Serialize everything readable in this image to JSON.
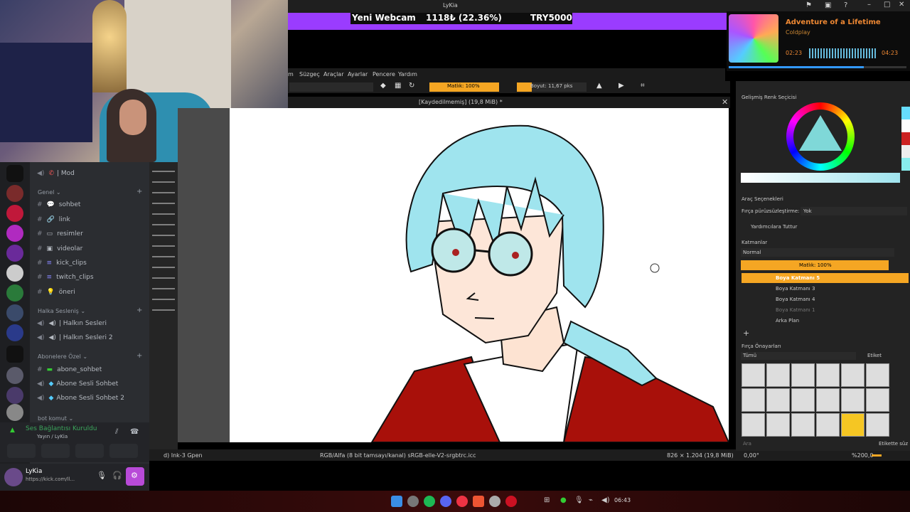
{
  "topbar": {
    "window_title": "LyKia"
  },
  "alert": {
    "label": "Yeni Webcam",
    "amount": "1118₺ (22.36%)",
    "goal": "TRY5000"
  },
  "music": {
    "title": "Adventure of a Lifetime",
    "artist": "Coldplay",
    "elapsed": "02:23",
    "total": "04:23"
  },
  "discord": {
    "top_channel": "| Mod",
    "categories": {
      "general": "Genel",
      "voice": "Halka Sesleniş",
      "subs": "Abonelere Özel",
      "bot": "bot komut"
    },
    "text_channels": [
      "sohbet",
      "link",
      "resimler",
      "videolar",
      "kick_clips",
      "twitch_clips",
      "öneri"
    ],
    "voice_channels": [
      "| Halkın Sesleri",
      "| Halkın Sesleri 2"
    ],
    "sub_channels": [
      "abone_sohbet",
      "Abone Sesli Sohbet",
      "Abone Sesli Sohbet 2"
    ],
    "voice_status": "Ses Bağlantısı Kuruldu",
    "voice_channel": "Yayın / LyKia",
    "username": "LyKia",
    "status_text": "https://kick.com/ll..."
  },
  "krita": {
    "menu": [
      "m",
      "Süzgeç",
      "Araçlar",
      "Ayarlar",
      "Pencere",
      "Yardım"
    ],
    "opacity": "Matlık: 100%",
    "size": "Boyut: 11,67 pks",
    "doc_title": "[Kaydedilmemiş]  (19,8 MiB) *",
    "status_brush": "d) Ink-3 Gpen",
    "status_color": "RGB/Alfa (8 bit tamsayı/kanal)  sRGB-elle-V2-srgbtrc.icc",
    "status_size": "826 × 1.204 (19,8 MiB)",
    "status_angle": "0,00°",
    "status_zoom": "%200,0",
    "color_panel": "Gelişmiş Renk Seçicisi",
    "tool_panel": "Araç Seçenekleri",
    "smoothing_label": "Fırça pürüzsüzleştirme:",
    "smoothing_value": "Yok",
    "assist_label": "Yardımcılara Tuttur",
    "layers_panel": "Katmanlar",
    "blend_mode": "Normal",
    "layer_opacity": "Matlık:  100%",
    "layers": [
      "Boya Katmanı 5",
      "Boya Katmanı 3",
      "Boya Katmanı 4",
      "Boya Katmanı 1",
      "Arka Plan"
    ],
    "presets_panel": "Fırça Önayarları",
    "presets_filter": "Tümü",
    "presets_tag": "Etiket",
    "search_placeholder": "Ara",
    "tag_filter": "Etikette süz"
  },
  "taskbar": {
    "time": "06:43"
  },
  "colors": {
    "accent": "#f5a623",
    "alert": "#9a3cff",
    "discord_bg": "#2b2d31",
    "hair": "#9fe4ee"
  }
}
